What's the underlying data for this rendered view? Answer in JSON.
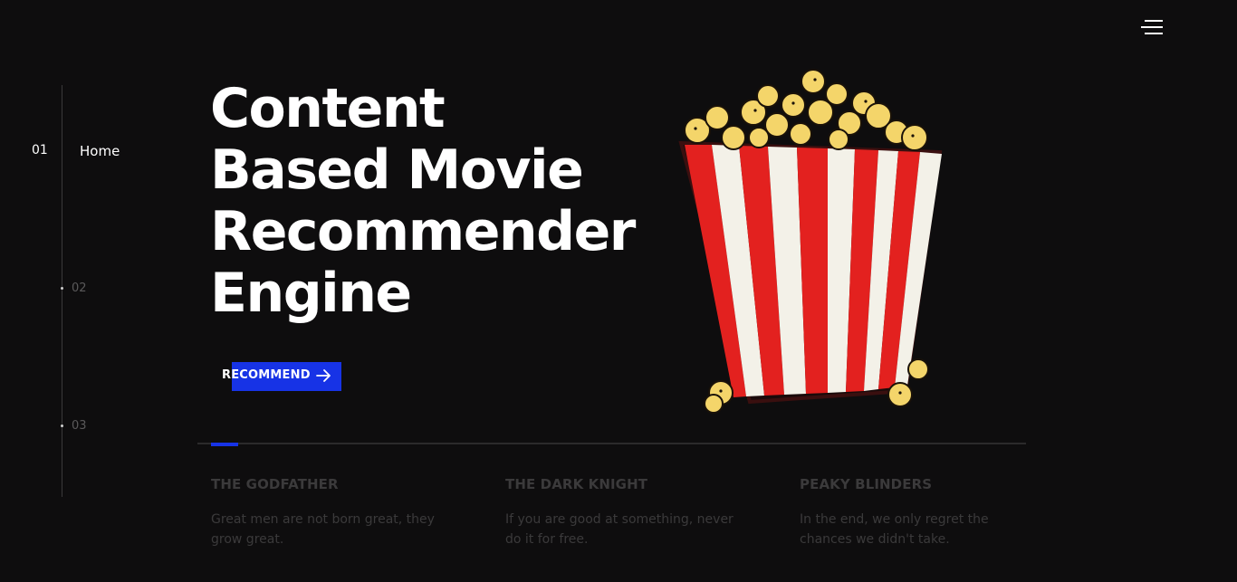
{
  "nav": {
    "items": [
      {
        "num": "01",
        "label": "Home"
      },
      {
        "num": "02",
        "label": ""
      },
      {
        "num": "03",
        "label": ""
      }
    ]
  },
  "hero": {
    "title_lines": [
      "Content",
      "Based Movie",
      "Recommender",
      "Engine"
    ],
    "button_label": "RECOMMEND"
  },
  "quotes": [
    {
      "title": "THE GODFATHER",
      "text": "Great men are not born great, they grow great."
    },
    {
      "title": "THE DARK KNIGHT",
      "text": "If you are good at something, never do it for free."
    },
    {
      "title": "PEAKY BLINDERS",
      "text": "In the end, we only regret the chances we didn't take."
    }
  ],
  "icons": {
    "menu": "hamburger-menu-icon",
    "arrow": "arrow-right-icon",
    "illustration": "popcorn-bucket-illustration"
  },
  "colors": {
    "background": "#0e0d0e",
    "accent": "#1733e6",
    "popcorn_red": "#e3211f",
    "popcorn_white": "#f3f1e8",
    "popcorn_kernel": "#f4d56a"
  }
}
